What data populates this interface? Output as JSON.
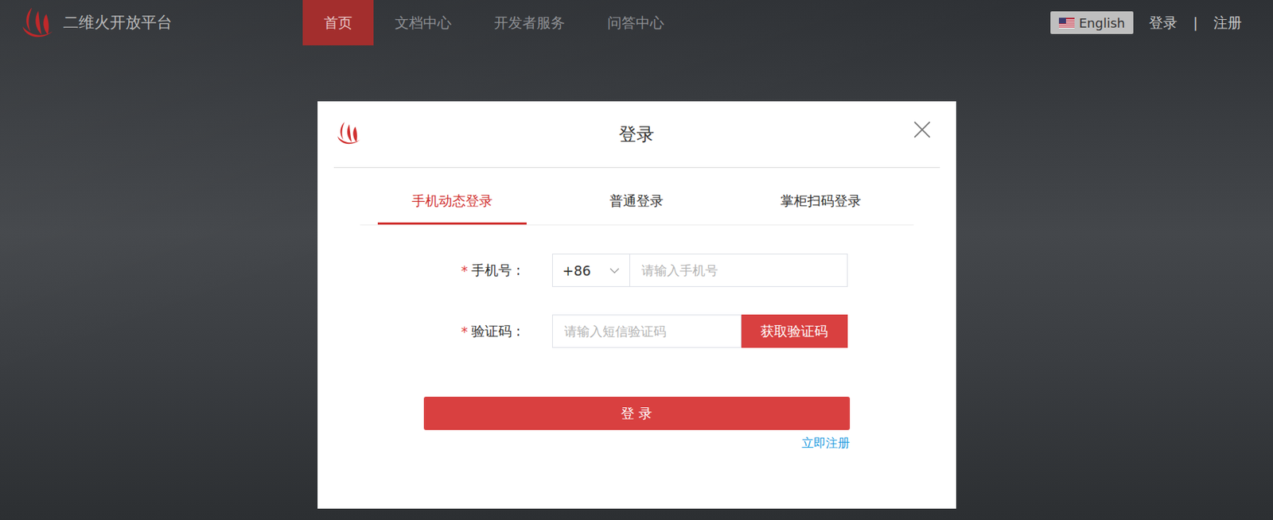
{
  "header": {
    "brand": "二维火开放平台",
    "nav": [
      {
        "label": "首页",
        "selected": true
      },
      {
        "label": "文档中心",
        "selected": false
      },
      {
        "label": "开发者服务",
        "selected": false
      },
      {
        "label": "问答中心",
        "selected": false
      }
    ],
    "language": "English",
    "login": "登录",
    "separator": "|",
    "register": "注册"
  },
  "modal": {
    "title": "登录",
    "tabs": [
      {
        "label": "手机动态登录",
        "selected": true
      },
      {
        "label": "普通登录",
        "selected": false
      },
      {
        "label": "掌柜扫码登录",
        "selected": false
      }
    ],
    "required_mark": "*",
    "fields": [
      {
        "kind": "phone",
        "label": "手机号 :",
        "required": true,
        "prefix": "+86",
        "placeholder": "请输入手机号"
      },
      {
        "kind": "code",
        "label": "验证码 :",
        "required": true,
        "placeholder": "请输入短信验证码",
        "button": "获取验证码"
      }
    ],
    "submit": "登 录",
    "register_link": "立即注册"
  }
}
